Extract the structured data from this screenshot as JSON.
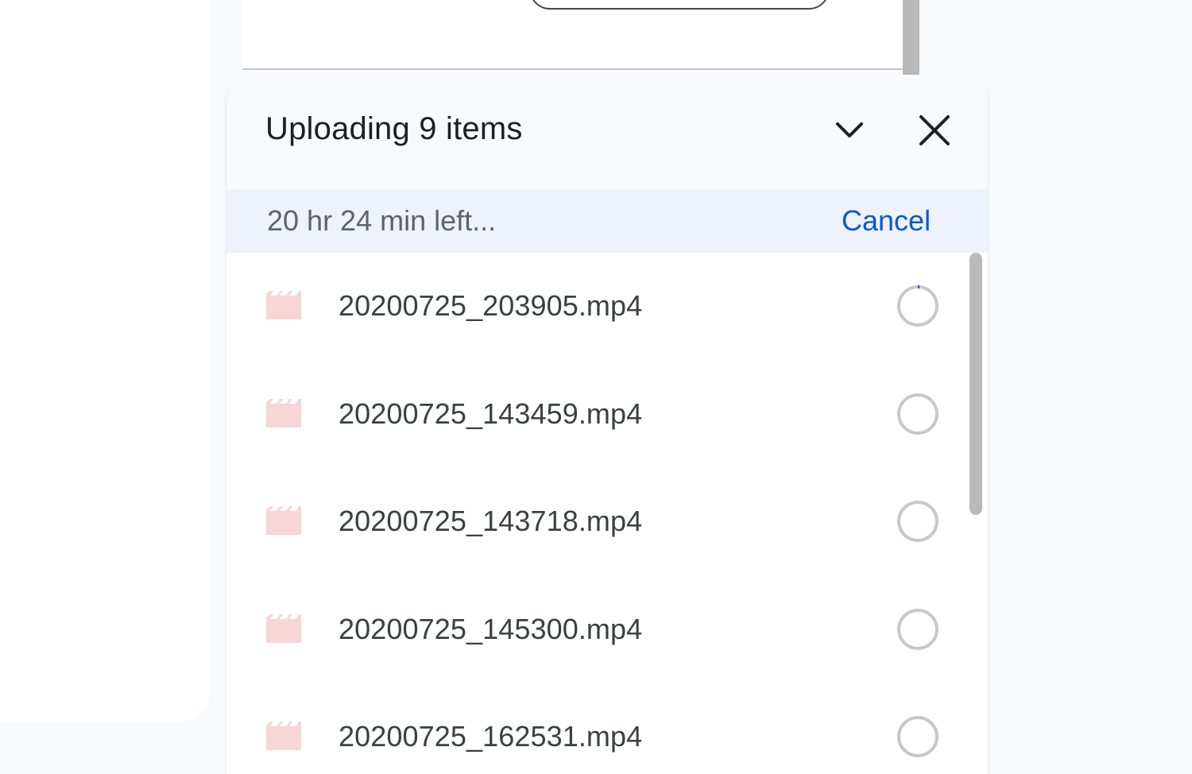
{
  "panel": {
    "title": "Uploading 9 items",
    "status": "20 hr 24 min left...",
    "cancel_label": "Cancel",
    "accent": "#0b57d0",
    "file_icon_color": "#f6d6d6"
  },
  "files": [
    {
      "name": "20200725_203905.mp4"
    },
    {
      "name": "20200725_143459.mp4"
    },
    {
      "name": "20200725_143718.mp4"
    },
    {
      "name": "20200725_145300.mp4"
    },
    {
      "name": "20200725_162531.mp4"
    }
  ],
  "icons": {
    "collapse": "chevron-down-icon",
    "close": "close-icon",
    "file": "video-file-icon",
    "progress": "progress-ring-icon"
  }
}
